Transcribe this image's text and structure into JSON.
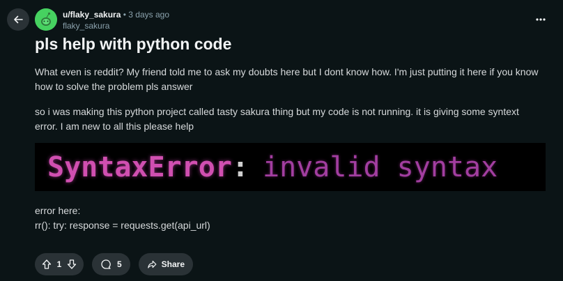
{
  "post": {
    "username": "u/flaky_sakura",
    "separator": "•",
    "time": "3 days ago",
    "display_name": "flaky_sakura",
    "title": "pls help with python code",
    "paragraph1": "What even is reddit? My friend told me to ask my doubts here but I dont know how. I'm just putting it here if you know how to solve the problem pls answer",
    "paragraph2": "so i was making this python project called tasty sakura thing but my code is not running. it is giving some syntext error. I am new to all this please help",
    "image": {
      "error_name": "SyntaxError",
      "colon": ":",
      "error_message": "invalid syntax"
    },
    "paragraph3_line1": "error here:",
    "paragraph3_line2": "rr(): try: response = requests.get(api_url)"
  },
  "actions": {
    "vote_count": "1",
    "comment_count": "5",
    "share_label": "Share"
  },
  "icons": {
    "back": "arrow-left-icon",
    "more": "more-horizontal-icon",
    "upvote": "arrow-up-icon",
    "downvote": "arrow-down-icon",
    "comment": "comment-bubble-icon",
    "share": "share-icon"
  },
  "colors": {
    "background": "#0b1416",
    "pill": "#2a3236",
    "avatar": "#46d160",
    "error_pink": "#d04fb0"
  }
}
